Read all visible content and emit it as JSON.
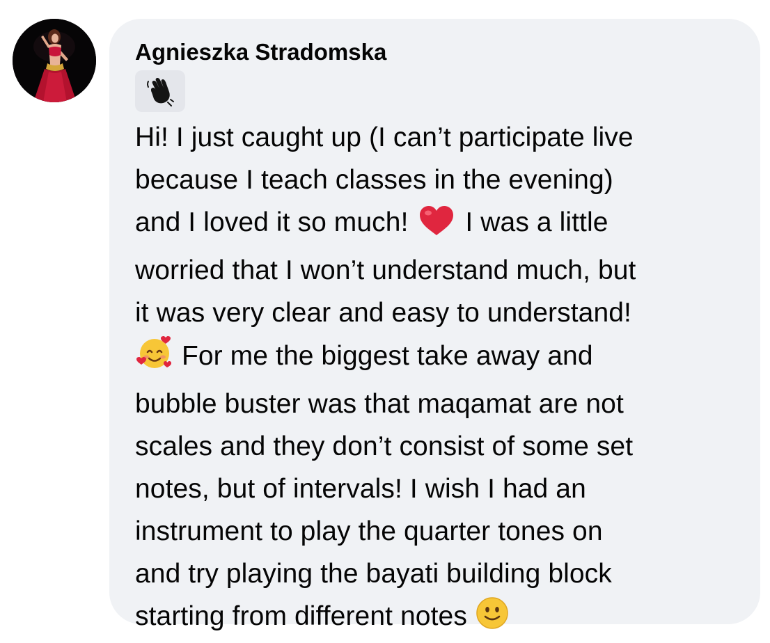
{
  "comment": {
    "author": "Agnieszka Stradomska",
    "sticker_icon": "waving-hand-icon",
    "lines": [
      "Hi! I just caught up (I can’t participate live",
      "because I teach classes in the evening)",
      "and I loved it so much!",
      "I was a little",
      "worried that I won’t understand much, but",
      "it was very clear and easy to understand!",
      "For me the biggest take away and",
      "bubble buster was that maqamat are not",
      "scales and they don’t consist of some set",
      "notes, but of intervals! I wish I had an",
      "instrument to play the quarter tones on",
      "and try playing the bayati building block",
      "starting from different notes"
    ],
    "emojis": [
      "red-heart-emoji",
      "smiling-face-with-hearts-emoji",
      "slightly-smiling-face-emoji"
    ]
  },
  "colors": {
    "bubble_bg": "#f0f2f5",
    "chip_bg": "#e4e6eb",
    "text": "#050505",
    "heart": "#e0263f",
    "emoji_face": "#f7c637"
  }
}
